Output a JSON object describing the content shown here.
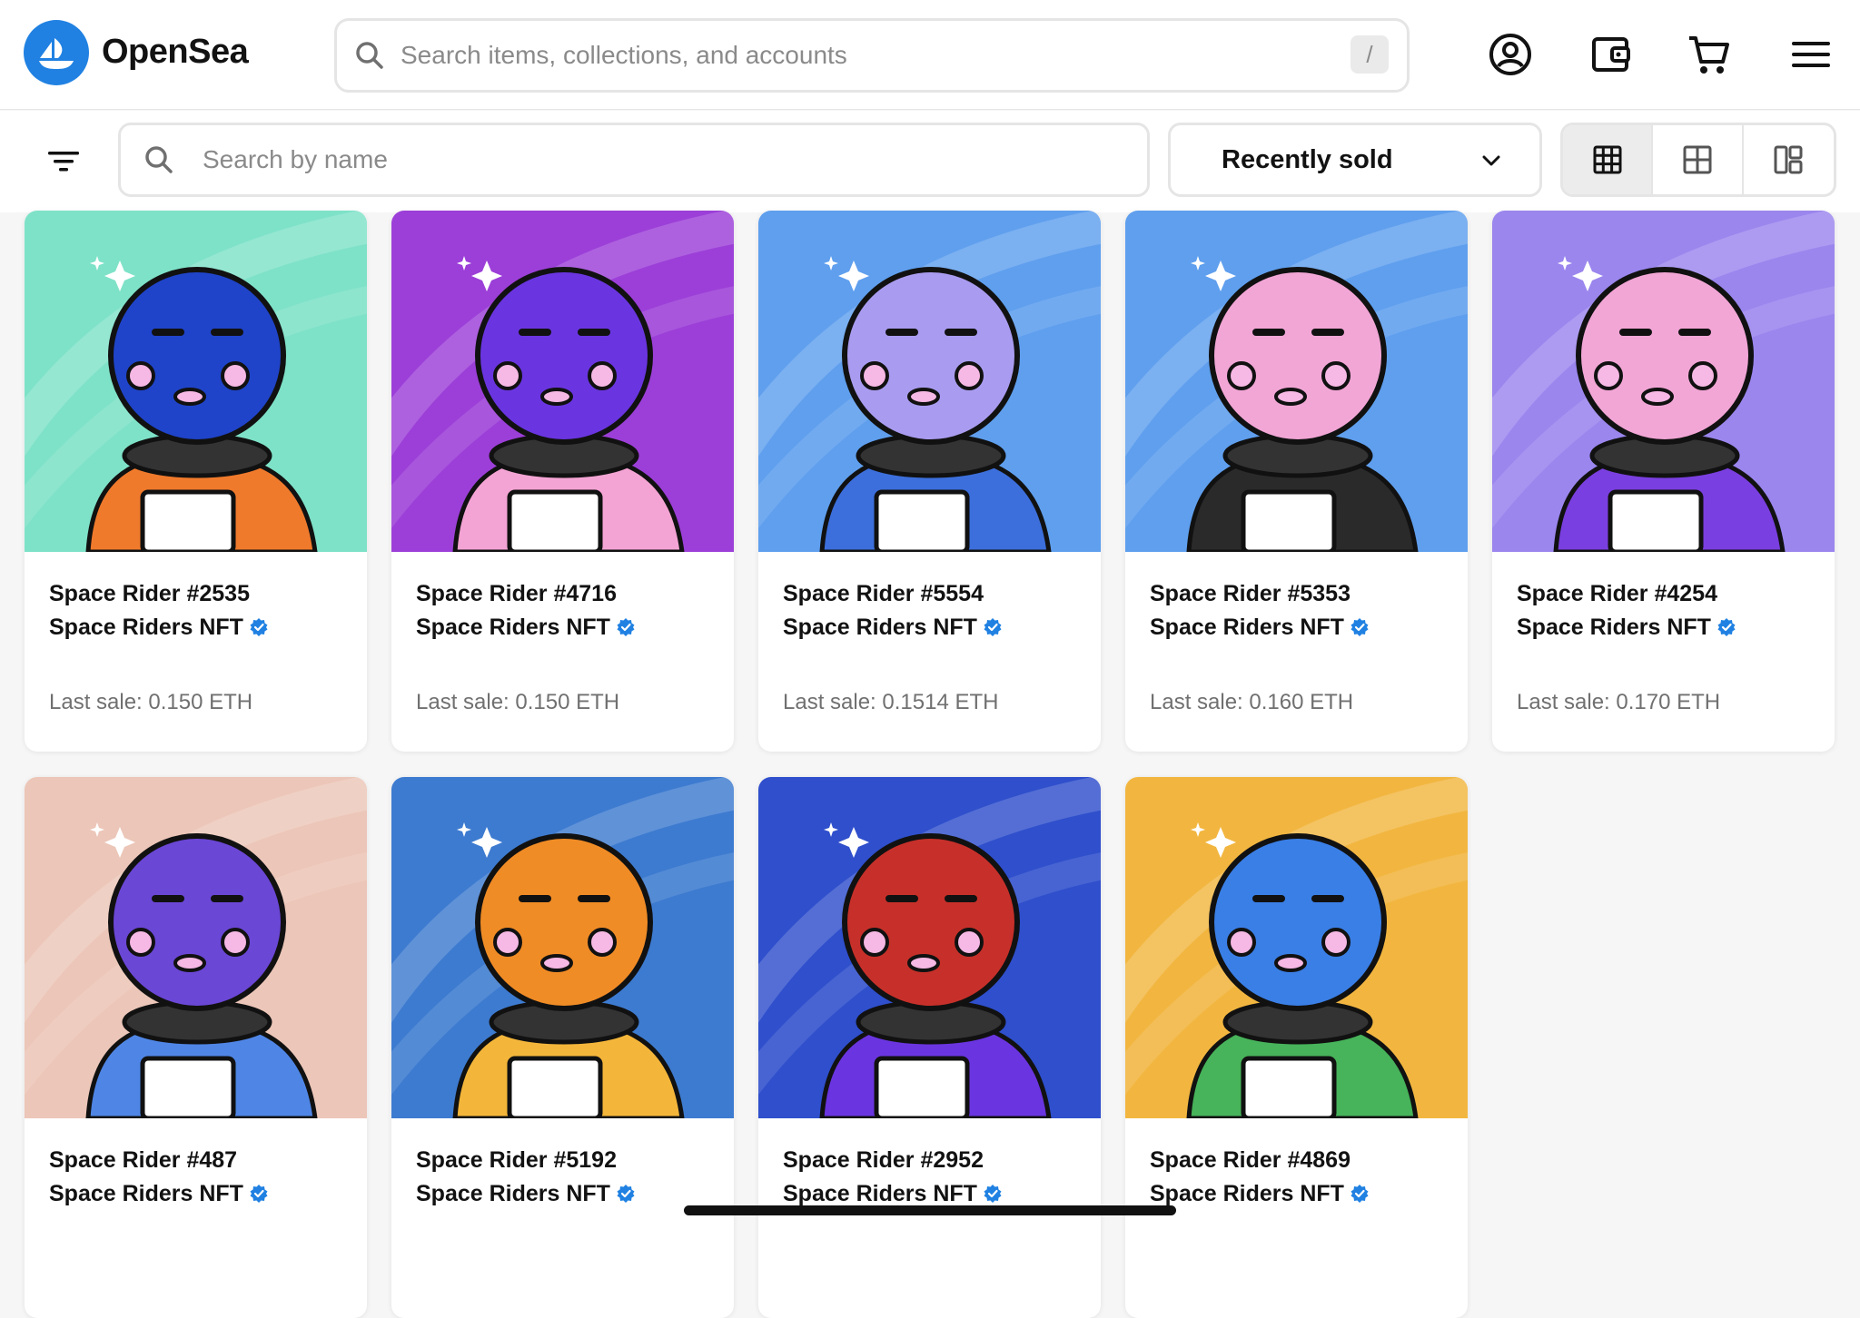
{
  "header": {
    "brand": "OpenSea",
    "search_placeholder": "Search items, collections, and accounts",
    "search_shortcut": "/"
  },
  "toolbar": {
    "name_search_placeholder": "Search by name",
    "sort_selected": "Recently sold"
  },
  "cards": [
    {
      "title": "Space Rider #2535",
      "collection": "Space Riders NFT",
      "sale_label": "Last sale:",
      "sale_value": "0.150 ETH",
      "bg": "#7ee2c8",
      "face": "#1f44c9",
      "suit": "#f07a2c"
    },
    {
      "title": "Space Rider #4716",
      "collection": "Space Riders NFT",
      "sale_label": "Last sale:",
      "sale_value": "0.150 ETH",
      "bg": "#9c3fd8",
      "face": "#6a35e0",
      "suit": "#f4a4d4"
    },
    {
      "title": "Space Rider #5554",
      "collection": "Space Riders NFT",
      "sale_label": "Last sale:",
      "sale_value": "0.1514 ETH",
      "bg": "#5f9fee",
      "face": "#a99cf0",
      "suit": "#3c6fdc"
    },
    {
      "title": "Space Rider #5353",
      "collection": "Space Riders NFT",
      "sale_label": "Last sale:",
      "sale_value": "0.160 ETH",
      "bg": "#5f9fee",
      "face": "#f2a6d6",
      "suit": "#2a2a2a"
    },
    {
      "title": "Space Rider #4254",
      "collection": "Space Riders NFT",
      "sale_label": "Last sale:",
      "sale_value": "0.170 ETH",
      "bg": "#9b86ee",
      "face": "#f2a6d6",
      "suit": "#7a3fe0"
    },
    {
      "title": "Space Rider #487",
      "collection": "Space Riders NFT",
      "sale_label": "",
      "sale_value": "",
      "bg": "#ecc6b8",
      "face": "#6b47d6",
      "suit": "#4f86e6"
    },
    {
      "title": "Space Rider #5192",
      "collection": "Space Riders NFT",
      "sale_label": "",
      "sale_value": "",
      "bg": "#3d7bd0",
      "face": "#f08c26",
      "suit": "#f4b63a"
    },
    {
      "title": "Space Rider #2952",
      "collection": "Space Riders NFT",
      "sale_label": "",
      "sale_value": "",
      "bg": "#2f4fcc",
      "face": "#c7302a",
      "suit": "#6a35e0"
    },
    {
      "title": "Space Rider #4869",
      "collection": "Space Riders NFT",
      "sale_label": "",
      "sale_value": "",
      "bg": "#f2b640",
      "face": "#3a7fe6",
      "suit": "#47b35a"
    }
  ],
  "colors": {
    "accent": "#2081e2",
    "verified": "#2081e2"
  }
}
